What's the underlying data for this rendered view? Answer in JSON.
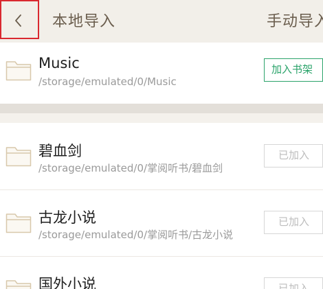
{
  "header": {
    "title": "本地导入",
    "manual_tab": "手动导入",
    "back_icon": "chevron-left-icon"
  },
  "colors": {
    "header_bg": "#f2efe9",
    "accent_green": "#2aa36a",
    "folder_tint": "#e8dcc6",
    "highlight_red": "#d9282f"
  },
  "rows": [
    {
      "name": "Music",
      "path": "/storage/emulated/0/Music",
      "action": "加入书架",
      "state": "add",
      "icon": "folder-icon"
    },
    {
      "name": "碧血剑",
      "path": "/storage/emulated/0/掌阅听书/碧血剑",
      "action": "已加入",
      "state": "added",
      "icon": "folder-icon"
    },
    {
      "name": "古龙小说",
      "path": "/storage/emulated/0/掌阅听书/古龙小说",
      "action": "已加入",
      "state": "added",
      "icon": "folder-icon"
    },
    {
      "name": "国外小说",
      "path": "",
      "action": "已加入",
      "state": "added",
      "icon": "folder-icon"
    }
  ]
}
